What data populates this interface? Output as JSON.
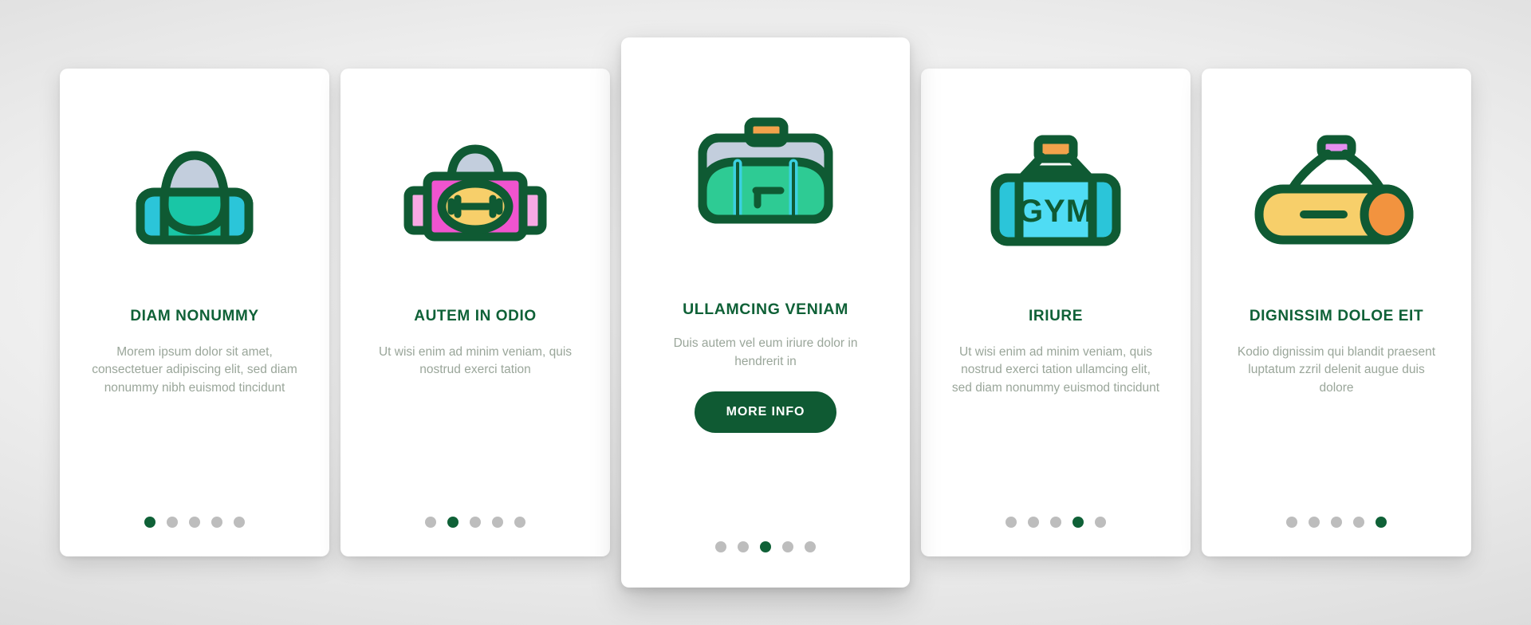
{
  "theme": {
    "accent_green": "#0f6137",
    "button_green": "#0f5a33",
    "body_text_gray": "#9aa69a",
    "dot_inactive": "#bdbdbd",
    "card_bg": "#ffffff",
    "page_bg": "#c9c9c9"
  },
  "cards": [
    {
      "icon": "duffel-bag-cyan-icon",
      "title": "DIAM NONUMMY",
      "body": "Morem ipsum dolor sit amet, consectetuer adipiscing elit, sed diam nonummy nibh euismod tincidunt",
      "featured": false,
      "dots": {
        "count": 5,
        "active_index": 0
      }
    },
    {
      "icon": "gym-bag-pink-dumbbell-icon",
      "title": "AUTEM IN ODIO",
      "body": "Ut wisi enim ad minim veniam, quis nostrud exerci tation",
      "featured": false,
      "dots": {
        "count": 5,
        "active_index": 1
      }
    },
    {
      "icon": "duffel-bag-green-icon",
      "title": "ULLAMCING VENIAM",
      "body": "Duis autem vel eum iriure dolor in hendrerit in",
      "button_label": "MORE INFO",
      "featured": true,
      "dots": {
        "count": 5,
        "active_index": 2
      }
    },
    {
      "icon": "gym-bag-blue-icon",
      "title": "IRIURE",
      "body": "Ut wisi enim ad minim veniam, quis nostrud exerci tation ullamcing elit, sed diam nonummy euismod tincidunt",
      "featured": false,
      "dots": {
        "count": 5,
        "active_index": 3
      }
    },
    {
      "icon": "barrel-bag-orange-icon",
      "title": "DIGNISSIM DOLOE EIT",
      "body": "Kodio dignissim qui blandit praesent luptatum zzril delenit augue duis dolore",
      "featured": false,
      "dots": {
        "count": 5,
        "active_index": 4
      }
    }
  ]
}
